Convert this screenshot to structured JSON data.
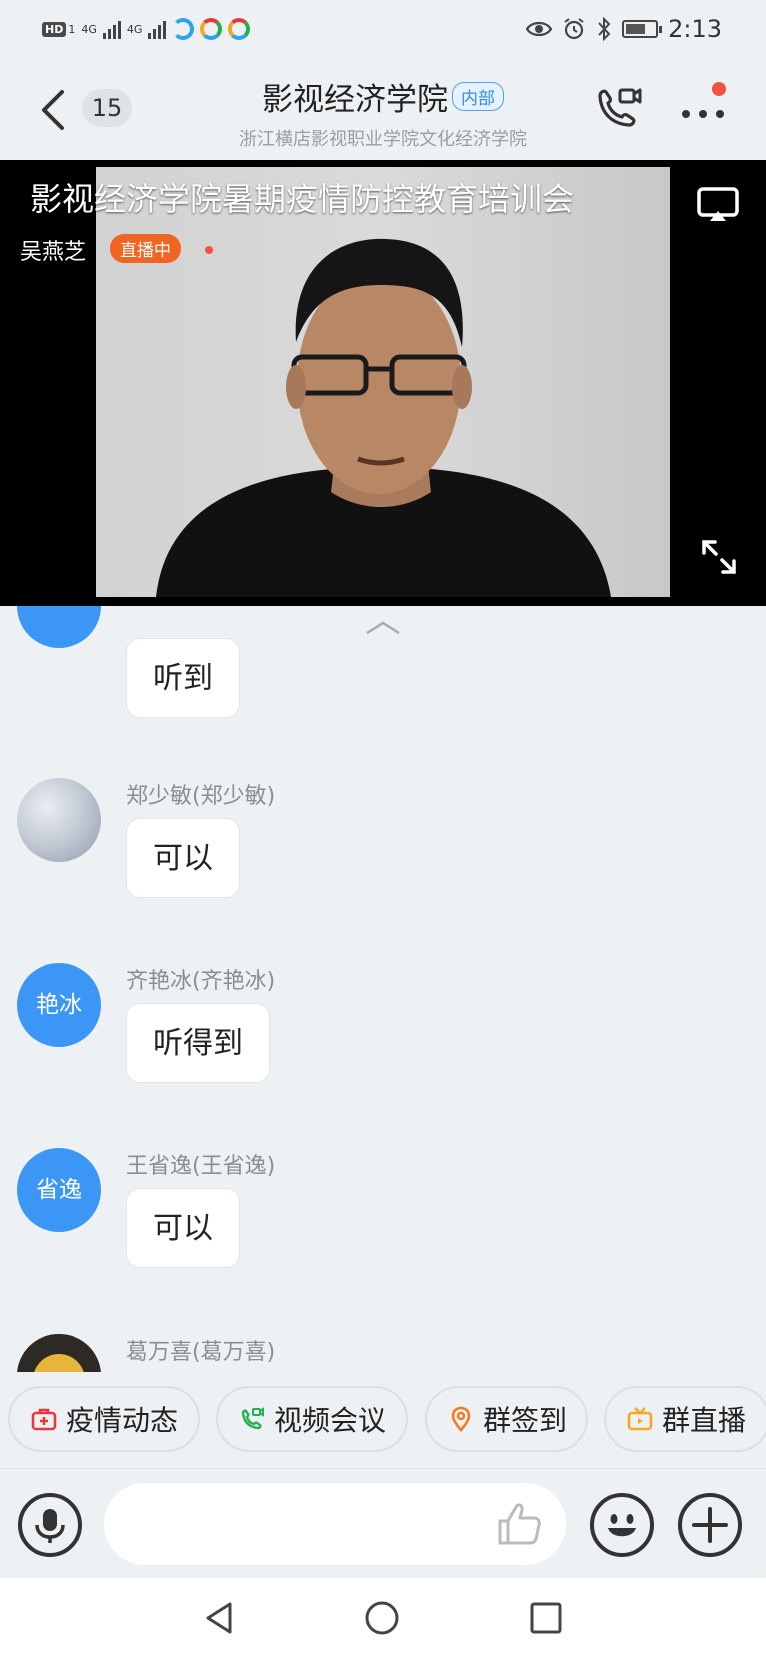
{
  "status_bar": {
    "hd_label": "HD",
    "sim_slot": "1",
    "net_1": "4G",
    "net_2": "4G",
    "time": "2:13"
  },
  "header": {
    "unread_count": "15",
    "title": "影视经济学院",
    "tag": "内部",
    "subtitle": "浙江横店影视职业学院文化经济学院"
  },
  "live": {
    "title": "影视经济学院暑期疫情防控教育培训会",
    "host": "吴燕芝",
    "status_badge": "直播中"
  },
  "messages": [
    {
      "sender": "",
      "avatar_text": "",
      "text": "听到"
    },
    {
      "sender": "郑少敏(郑少敏)",
      "avatar_text": "",
      "text": "可以"
    },
    {
      "sender": "齐艳冰(齐艳冰)",
      "avatar_text": "艳冰",
      "text": "听得到"
    },
    {
      "sender": "王省逸(王省逸)",
      "avatar_text": "省逸",
      "text": "可以"
    },
    {
      "sender": "葛万喜(葛万喜)",
      "avatar_text": "",
      "text": ""
    }
  ],
  "quick_apps": [
    {
      "label": "疫情动态",
      "icon": "medical-kit-icon",
      "color": "#e8383d"
    },
    {
      "label": "视频会议",
      "icon": "video-call-icon",
      "color": "#22b14c"
    },
    {
      "label": "群签到",
      "icon": "location-pin-icon",
      "color": "#f27b21"
    },
    {
      "label": "群直播",
      "icon": "tv-icon",
      "color": "#f5a623"
    }
  ],
  "input": {
    "placeholder": ""
  },
  "colors": {
    "accent_blue": "#3c96f5",
    "live_orange": "#f26422",
    "notify_red": "#f5533d"
  }
}
